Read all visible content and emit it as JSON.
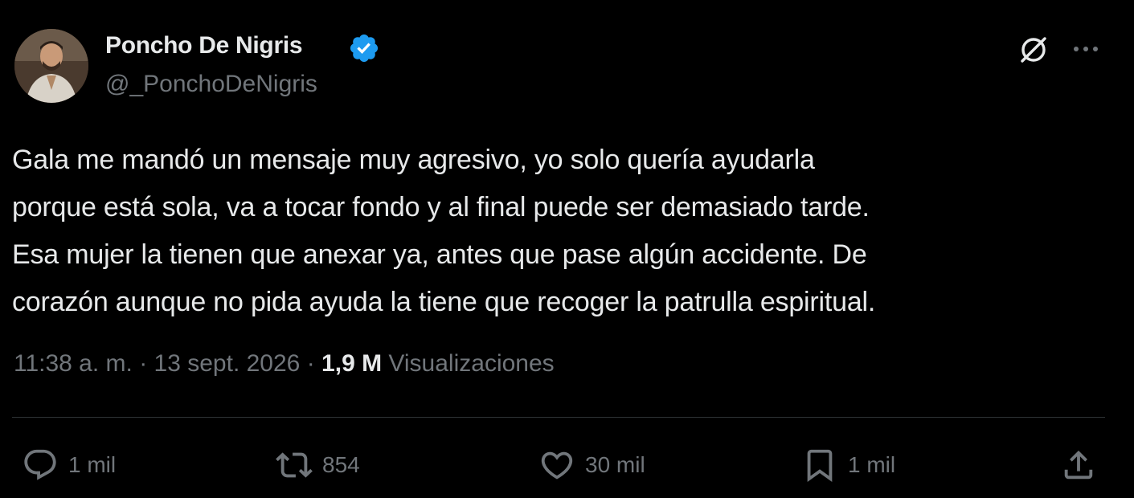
{
  "author": {
    "name": "Poncho De Nigris",
    "handle": "@_PonchoDeNigris",
    "verified_icon": "verified-badge-icon",
    "verified_color": "#1d9bf0"
  },
  "header_actions": {
    "grok_icon": "grok-icon",
    "more_icon": "more-options-icon"
  },
  "tweet": {
    "lines": [
      "Gala me mandó un mensaje muy agresivo, yo solo quería ayudarla",
      "porque está sola, va a tocar fondo y al final puede ser demasiado tarde.",
      "Esa mujer la tienen que anexar ya, antes que pase algún accidente.  De",
      "corazón aunque no pida ayuda la tiene que recoger la patrulla espiritual."
    ]
  },
  "meta": {
    "time": "11:38 a. m.",
    "separator": "·",
    "date": "13 sept. 2026",
    "views_count": "1,9 M",
    "views_label": "Visualizaciones"
  },
  "actions": {
    "reply": {
      "icon": "reply-icon",
      "count": "1 mil"
    },
    "retweet": {
      "icon": "retweet-icon",
      "count": "854"
    },
    "like": {
      "icon": "heart-icon",
      "count": "30 mil"
    },
    "bookmark": {
      "icon": "bookmark-icon",
      "count": "1 mil"
    },
    "share": {
      "icon": "share-icon"
    }
  },
  "colors": {
    "background": "#000000",
    "primary_text": "#e7e9ea",
    "secondary_text": "#71767b",
    "divider": "#2f3336"
  }
}
